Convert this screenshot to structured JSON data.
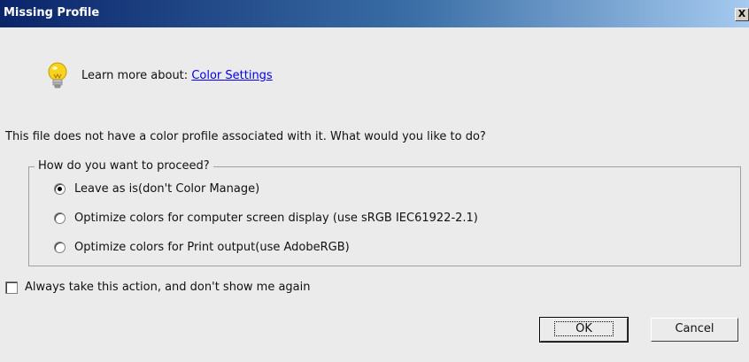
{
  "window": {
    "title": "Missing Profile",
    "close_label": "X"
  },
  "learn": {
    "prefix": "Learn more about:",
    "link_label": "Color Settings"
  },
  "question": "This file does not have a color profile associated with it. What would you like to do?",
  "group": {
    "legend": "How do you want to proceed?",
    "options": [
      {
        "label": "Leave as is(don't Color Manage)",
        "checked": true
      },
      {
        "label": "Optimize colors for computer screen display (use sRGB IEC61922-2.1)",
        "checked": false
      },
      {
        "label": "Optimize colors for Print output(use AdobeRGB)",
        "checked": false
      }
    ]
  },
  "always_action": {
    "label": "Always take this action, and don't show me again",
    "checked": false
  },
  "buttons": {
    "ok_label": "OK",
    "cancel_label": "Cancel"
  },
  "colors": {
    "title_bar_start": "#0a246a",
    "title_bar_end": "#a6caf0",
    "link": "#0000ee",
    "bulb": "#f5c400"
  },
  "icons": {
    "bulb": "lightbulb-icon",
    "close": "close-icon"
  }
}
